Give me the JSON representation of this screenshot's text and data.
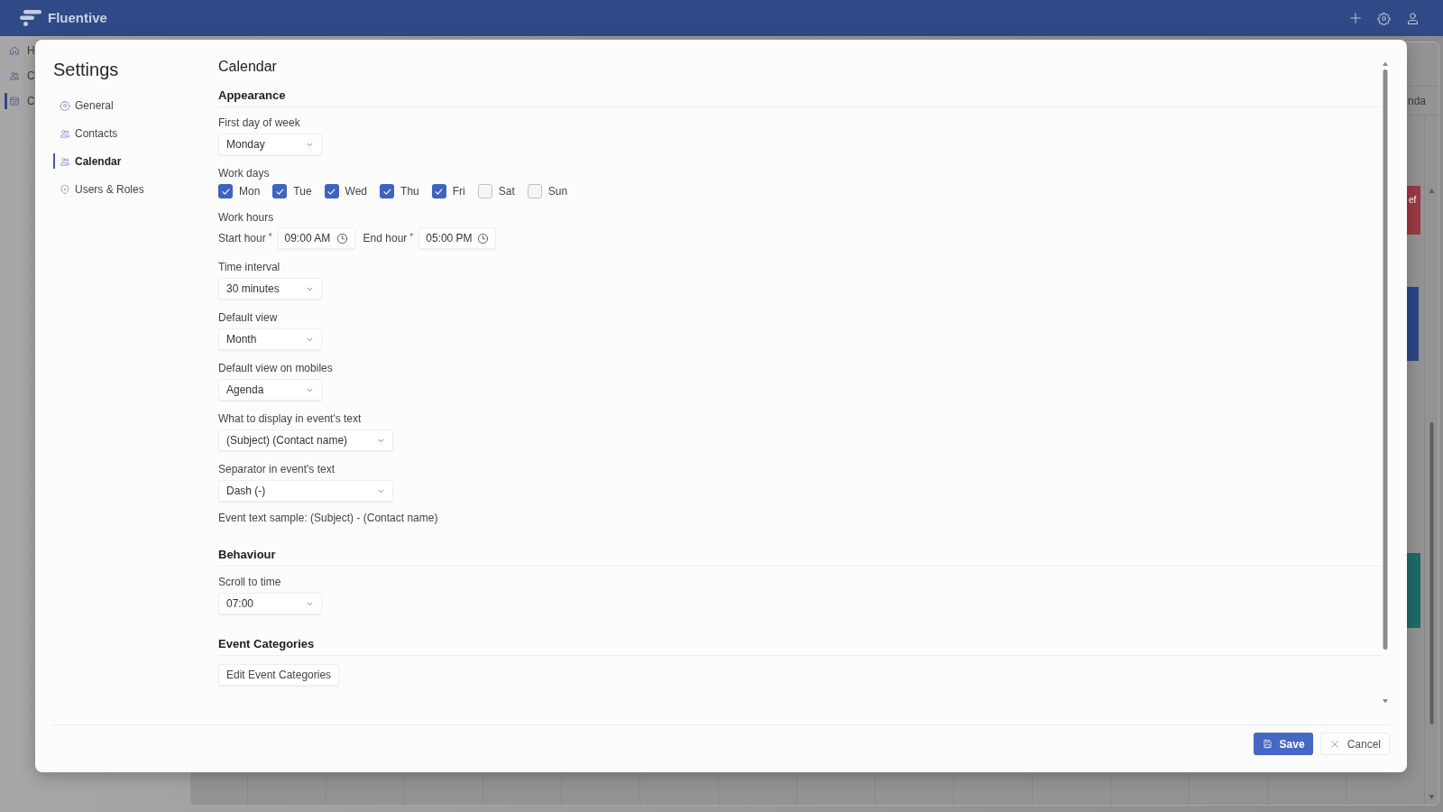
{
  "app_bar": {
    "title": "Fluentive"
  },
  "background_app": {
    "sidebar_items": [
      {
        "label": "H",
        "selected": false
      },
      {
        "label": "C",
        "selected": false
      },
      {
        "label": "C",
        "selected": true
      }
    ],
    "column_header": "nda",
    "events": [
      {
        "text": "ef",
        "color": "#9b3a44"
      },
      {
        "color": "#2c4786"
      },
      {
        "color": "#1f6b67"
      }
    ]
  },
  "settings_dialog": {
    "title": "Settings",
    "nav": [
      {
        "label": "General",
        "selected": false
      },
      {
        "label": "Contacts",
        "selected": false
      },
      {
        "label": "Calendar",
        "selected": true
      },
      {
        "label": "Users & Roles",
        "selected": false
      }
    ],
    "page_title": "Calendar",
    "sections": [
      {
        "title": "Appearance",
        "fields": [
          {
            "kind": "dropdown",
            "label": "First day of week",
            "value": "Monday"
          },
          {
            "kind": "checkboxes",
            "label": "Work days",
            "options": [
              {
                "label": "Mon",
                "checked": true
              },
              {
                "label": "Tue",
                "checked": true
              },
              {
                "label": "Wed",
                "checked": true
              },
              {
                "label": "Thu",
                "checked": true
              },
              {
                "label": "Fri",
                "checked": true
              },
              {
                "label": "Sat",
                "checked": false
              },
              {
                "label": "Sun",
                "checked": false
              }
            ]
          },
          {
            "kind": "time_range",
            "label": "Work hours",
            "times": [
              {
                "label": "Start hour",
                "required_mark": "*",
                "value": "09:00 AM"
              },
              {
                "label": "End hour",
                "required_mark": "*",
                "value": "05:00 PM"
              }
            ]
          },
          {
            "kind": "dropdown",
            "label": "Time interval",
            "value": "30 minutes"
          },
          {
            "kind": "dropdown",
            "label": "Default view",
            "value": "Month"
          },
          {
            "kind": "dropdown",
            "label": "Default view on mobiles",
            "value": "Agenda"
          },
          {
            "kind": "wide_dropdown",
            "label": "What to display in event's text",
            "value": "(Subject) (Contact name)"
          },
          {
            "kind": "wide_dropdown",
            "label": "Separator in event's text",
            "value": "Dash (-)"
          },
          {
            "kind": "note",
            "text": "Event text sample: (Subject) - (Contact name)"
          }
        ]
      },
      {
        "title": "Behaviour",
        "fields": [
          {
            "kind": "dropdown",
            "label": "Scroll to time",
            "value": "07:00"
          }
        ]
      },
      {
        "title": "Event Categories",
        "fields": [
          {
            "kind": "button",
            "label": "Edit Event Categories"
          }
        ]
      }
    ],
    "buttons": [
      {
        "kind": "primary",
        "label": "Save"
      },
      {
        "kind": "secondary",
        "label": "Cancel"
      }
    ]
  }
}
